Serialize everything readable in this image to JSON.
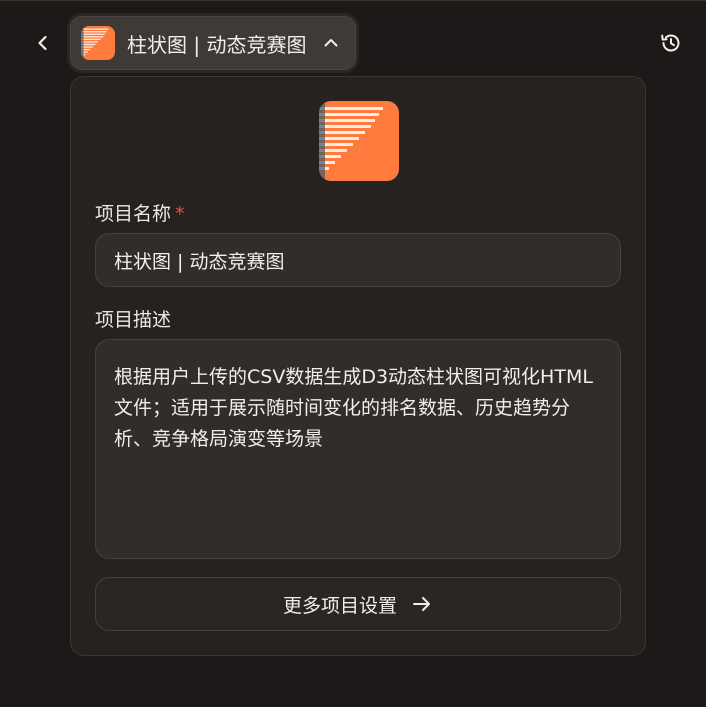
{
  "header": {
    "back_icon": "chevron-left-icon",
    "project_title": "柱状图 | 动态竞赛图",
    "project_icon": "bar-chart-race-icon",
    "collapse_icon": "chevron-up-icon",
    "history_icon": "history-icon"
  },
  "form": {
    "name_label": "项目名称",
    "required_mark": "*",
    "name_value": "柱状图 | 动态竞赛图",
    "desc_label": "项目描述",
    "desc_value": "根据用户上传的CSV数据生成D3动态柱状图可视化HTML文件；适用于展示随时间变化的排名数据、历史趋势分析、竞争格局演变等场景",
    "more_settings_label": "更多项目设置",
    "more_settings_icon": "arrow-right-icon"
  },
  "colors": {
    "background": "#1c1918",
    "panel": "#262220",
    "accent_orange": "#ff7a3d",
    "required_red": "#e5534b"
  }
}
